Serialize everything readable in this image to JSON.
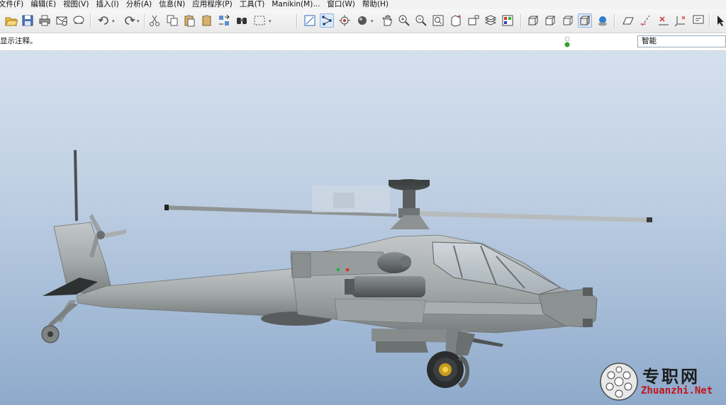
{
  "menu": {
    "items": [
      "文件(F)",
      "编辑(E)",
      "视图(V)",
      "插入(I)",
      "分析(A)",
      "信息(N)",
      "应用程序(P)",
      "工具(T)",
      "Manikin(M)...",
      "窗口(W)",
      "帮助(H)"
    ]
  },
  "status": {
    "message": "显示注释。",
    "filter_value": "智能"
  },
  "watermark": {
    "cn": "专职网",
    "en": "Zhuanzhi.Net"
  },
  "colors": {
    "menubar_bg": "#f2f2f2",
    "toolbar_bg": "#ececec",
    "viewport_top": "#d5e0ee",
    "viewport_bottom": "#8eaacb",
    "model_gray": "#a7acad",
    "watermark_red": "#c0141c"
  },
  "toolbar": {
    "icons": [
      "open-folder-icon",
      "save-icon",
      "print-icon",
      "email-icon",
      "mail-recipient-icon",
      "undo-icon",
      "redo-icon",
      "cut-icon",
      "copy-icon",
      "paste-icon",
      "paste-special-icon",
      "regenerate-icon",
      "find-icon",
      "select-box-icon",
      "sketch-icon",
      "datum-icon",
      "spin-center-icon",
      "display-style-icon",
      "pan-icon",
      "zoom-in-icon",
      "zoom-out-icon",
      "refit-icon",
      "reorient-icon",
      "saved-views-icon",
      "layers-icon",
      "appearance-icon",
      "wireframe-icon",
      "hidden-line-icon",
      "no-hidden-icon",
      "shading-icon",
      "model-tree-icon",
      "datum-plane-icon",
      "datum-axis-icon",
      "datum-point-icon",
      "coordinate-system-icon",
      "annotation-icon"
    ]
  }
}
